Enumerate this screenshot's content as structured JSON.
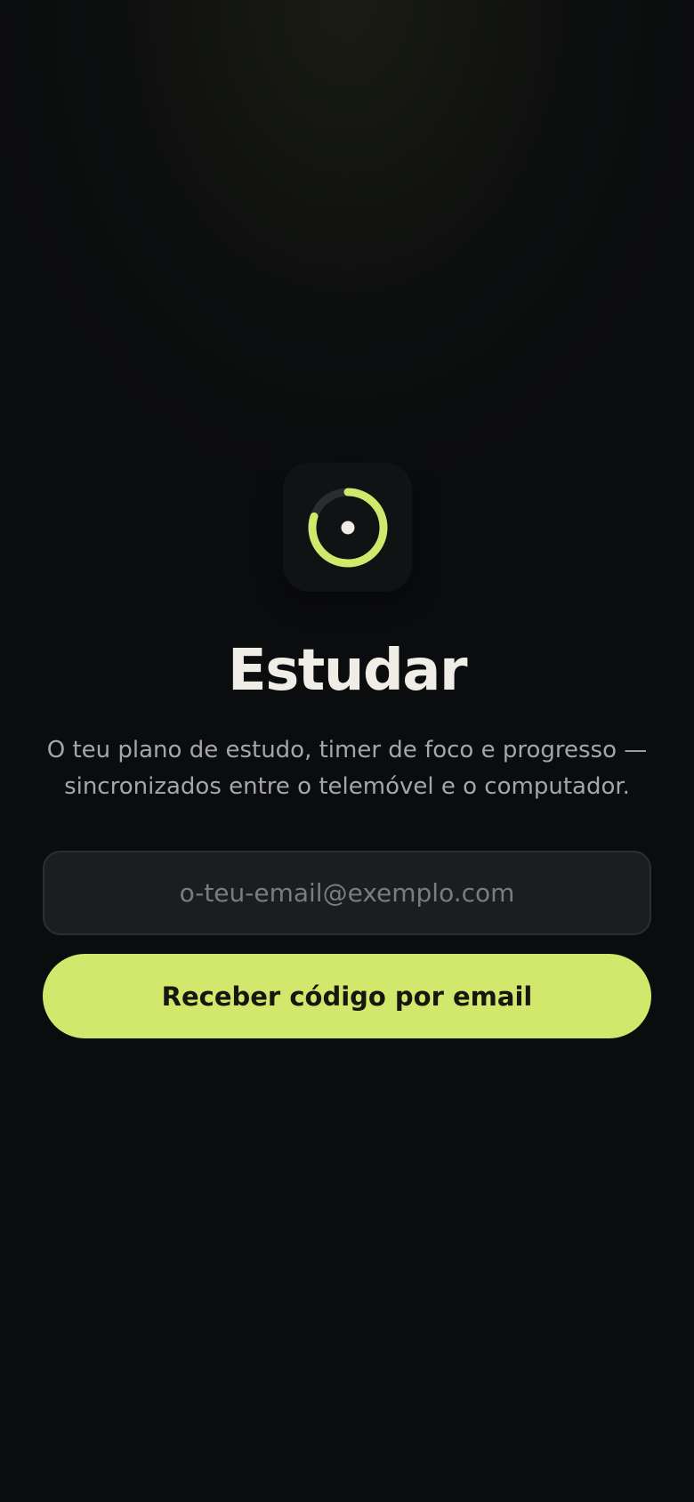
{
  "app": {
    "title": "Estudar",
    "subtitle": "O teu plano de estudo, timer de foco e progresso — sincronizados entre o telemóvel e o computador.",
    "logo_icon": "focus-ring-timer-icon",
    "logo_progress": 0.8
  },
  "login": {
    "email_value": "",
    "email_placeholder": "o-teu-email@exemplo.com",
    "submit_label": "Receber código por email"
  },
  "colors": {
    "background": "#0b0c0e",
    "accent": "#d1e86c",
    "title_text": "#f0ede6",
    "subtitle_text": "#a5a6a8",
    "input_background": "#1b1d21"
  }
}
